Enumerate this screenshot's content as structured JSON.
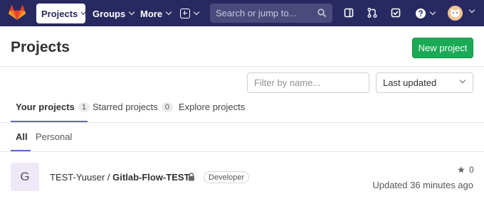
{
  "navbar": {
    "projects_label": "Projects",
    "groups_label": "Groups",
    "more_label": "More",
    "search_placeholder": "Search or jump to...",
    "colors": {
      "bg": "#292961",
      "accent": "#6666c4"
    }
  },
  "header": {
    "title": "Projects",
    "new_project_label": "New project"
  },
  "filters": {
    "filter_placeholder": "Filter by name...",
    "sort_label": "Last updated"
  },
  "tabs": [
    {
      "label": "Your projects",
      "count": "1"
    },
    {
      "label": "Starred projects",
      "count": "0"
    },
    {
      "label": "Explore projects"
    }
  ],
  "subtabs": [
    {
      "label": "All"
    },
    {
      "label": "Personal"
    }
  ],
  "projects": [
    {
      "avatar_letter": "G",
      "namespace": "TEST-Yuuser /",
      "name": "Gitlab-Flow-TEST",
      "role": "Developer",
      "stars": "0",
      "updated": "Updated 36 minutes ago"
    }
  ],
  "icons": [
    "gitlab-logo-icon",
    "plus-square-icon",
    "search-icon",
    "sidebar-icon",
    "merge-request-icon",
    "todo-icon",
    "help-icon",
    "lock-icon",
    "star-icon"
  ]
}
